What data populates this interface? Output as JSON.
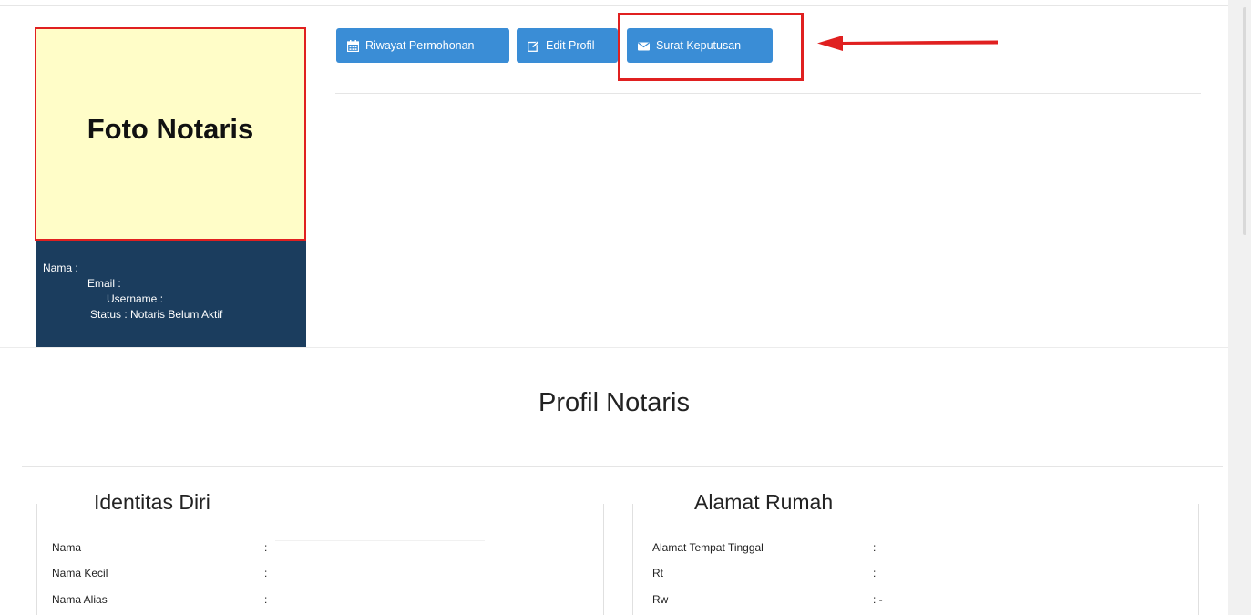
{
  "photo": {
    "title": "Foto Notaris"
  },
  "info": {
    "nama": "Nama :",
    "email": "Email :",
    "username": "Username :",
    "status": "Status : Notaris Belum Aktif"
  },
  "toolbar": {
    "riwayat_label": "Riwayat Permohonan",
    "edit_label": "Edit Profil",
    "surat_label": "Surat Keputusan"
  },
  "profile": {
    "title": "Profil Notaris",
    "identitas": {
      "heading": "Identitas Diri",
      "rows": [
        {
          "label": "Nama",
          "value": ":"
        },
        {
          "label": "Nama Kecil",
          "value": ":"
        },
        {
          "label": "Nama Alias",
          "value": ":"
        }
      ]
    },
    "alamat": {
      "heading": "Alamat Rumah",
      "rows": [
        {
          "label": "Alamat Tempat Tinggal",
          "value": ":"
        },
        {
          "label": "Rt",
          "value": ":"
        },
        {
          "label": "Rw",
          "value": ": -"
        }
      ]
    }
  },
  "colors": {
    "button": "#3a8dd6",
    "highlight": "#e02020",
    "panel": "#1b3d5e",
    "photo_bg": "#fffdc8"
  },
  "icons": [
    "calendar-icon",
    "edit-icon",
    "envelope-icon",
    "red-arrow-icon"
  ]
}
